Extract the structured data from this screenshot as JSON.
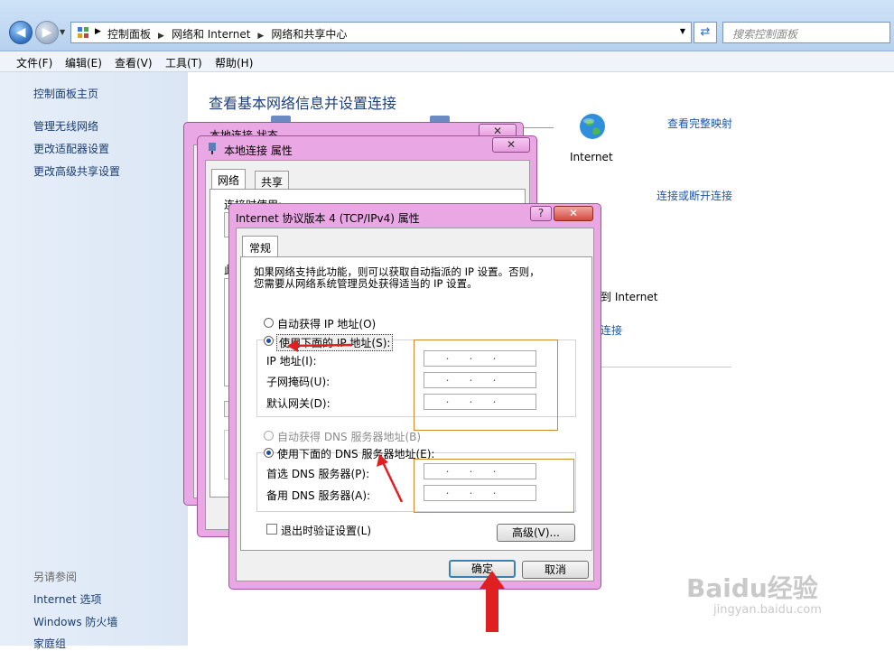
{
  "nav": {
    "breadcrumbs": [
      "控制面板",
      "网络和 Internet",
      "网络和共享中心"
    ],
    "search_placeholder": "搜索控制面板"
  },
  "menu": [
    "文件(F)",
    "编辑(E)",
    "查看(V)",
    "工具(T)",
    "帮助(H)"
  ],
  "sidebar": {
    "items": [
      "控制面板主页",
      "管理无线网络",
      "更改适配器设置",
      "更改高级共享设置"
    ],
    "see_also_heading": "另请参阅",
    "see_also": [
      "Internet 选项",
      "Windows 防火墙",
      "家庭组"
    ]
  },
  "main": {
    "title": "查看基本网络信息并设置连接",
    "internet_label": "Internet",
    "view_full_map": "查看完整映射",
    "connect_disconnect": "连接或断开连接",
    "partial_to_internet": "到 Internet",
    "partial_connect": "连接"
  },
  "status_window": {
    "title": "本地连接 状态"
  },
  "props_window": {
    "title": "本地连接 属性",
    "tabs": [
      "网络",
      "共享"
    ],
    "connect_using_partial": "连接时使用:",
    "partial_label": "此"
  },
  "ipv4_dialog": {
    "title": "Internet 协议版本 4 (TCP/IPv4) 属性",
    "help_symbol": "?",
    "close_symbol": "✕",
    "tab": "常规",
    "description_line1": "如果网络支持此功能，则可以获取自动指派的 IP 设置。否则，",
    "description_line2": "您需要从网络系统管理员处获得适当的 IP 设置。",
    "ip_auto": "自动获得 IP 地址(O)",
    "ip_manual": "使用下面的 IP 地址(S):",
    "ip_address": "IP 地址(I):",
    "subnet": "子网掩码(U):",
    "gateway": "默认网关(D):",
    "dns_auto": "自动获得 DNS 服务器地址(B)",
    "dns_manual": "使用下面的 DNS 服务器地址(E):",
    "dns_preferred": "首选 DNS 服务器(P):",
    "dns_alternate": "备用 DNS 服务器(A):",
    "ip_placeholder": "...",
    "validate_on_exit": "退出时验证设置(L)",
    "advanced": "高级(V)...",
    "ok": "确定",
    "cancel": "取消",
    "ip_mode": "manual",
    "dns_mode": "manual"
  },
  "watermark": {
    "brand": "Baidu经验",
    "url": "jingyan.baidu.com"
  },
  "colors": {
    "annotation_red": "#e02020",
    "annotation_box": "#d08a2b",
    "window_frame": "#e9a8e4"
  }
}
